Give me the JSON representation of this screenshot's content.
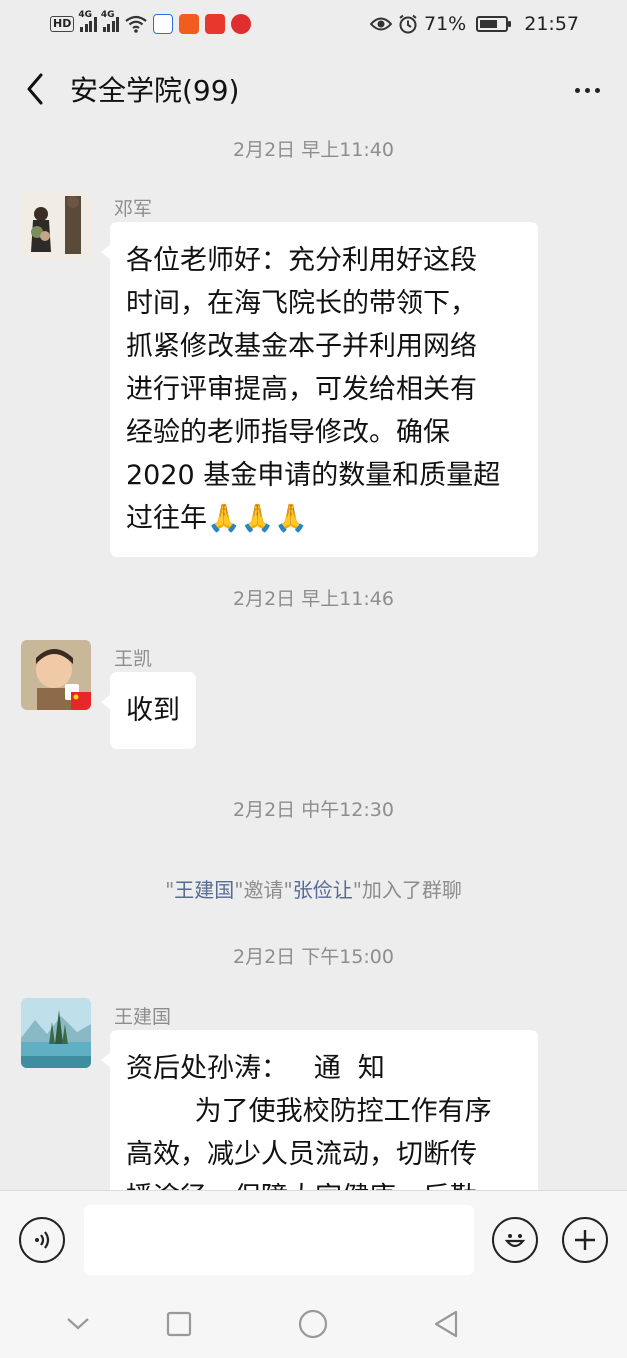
{
  "status": {
    "network_a": "HD",
    "net_gen_1": "4G",
    "net_gen_2": "4G",
    "battery_pct": "71%",
    "battery_level": 0.71,
    "time": "21:57"
  },
  "nav": {
    "title": "安全学院(99)"
  },
  "chat": {
    "time1": "2月2日 早上11:40",
    "msg1": {
      "sender": "邓军",
      "text": "各位老师好：充分利用好这段\n时间，在海飞院长的带领下，\n抓紧修改基金本子并利用网络\n进行评审提高，可发给相关有\n经验的老师指导修改。确保\n2020 基金申请的数量和质量超\n过往年🙏🙏🙏"
    },
    "time2": "2月2日 早上11:46",
    "msg2": {
      "sender": "王凯",
      "text": "收到"
    },
    "time3": "2月2日 中午12:30",
    "system": {
      "q1": "\"",
      "inviter": "王建国",
      "q2": "\"邀请\"",
      "invitee": "张俭让",
      "q3": "\"加入了群聊"
    },
    "time4": "2月2日 下午15:00",
    "msg3": {
      "sender": "王建国",
      "text": "资后处孙涛：   通  知\n        为了使我校防控工作有序\n高效，减少人员流动，切断传\n播途径，保障大家健康，后勤"
    }
  },
  "colors": {
    "background": "#ededed",
    "bubble": "#ffffff",
    "link_name": "#576b95",
    "muted_text": "#8d8d8d"
  }
}
